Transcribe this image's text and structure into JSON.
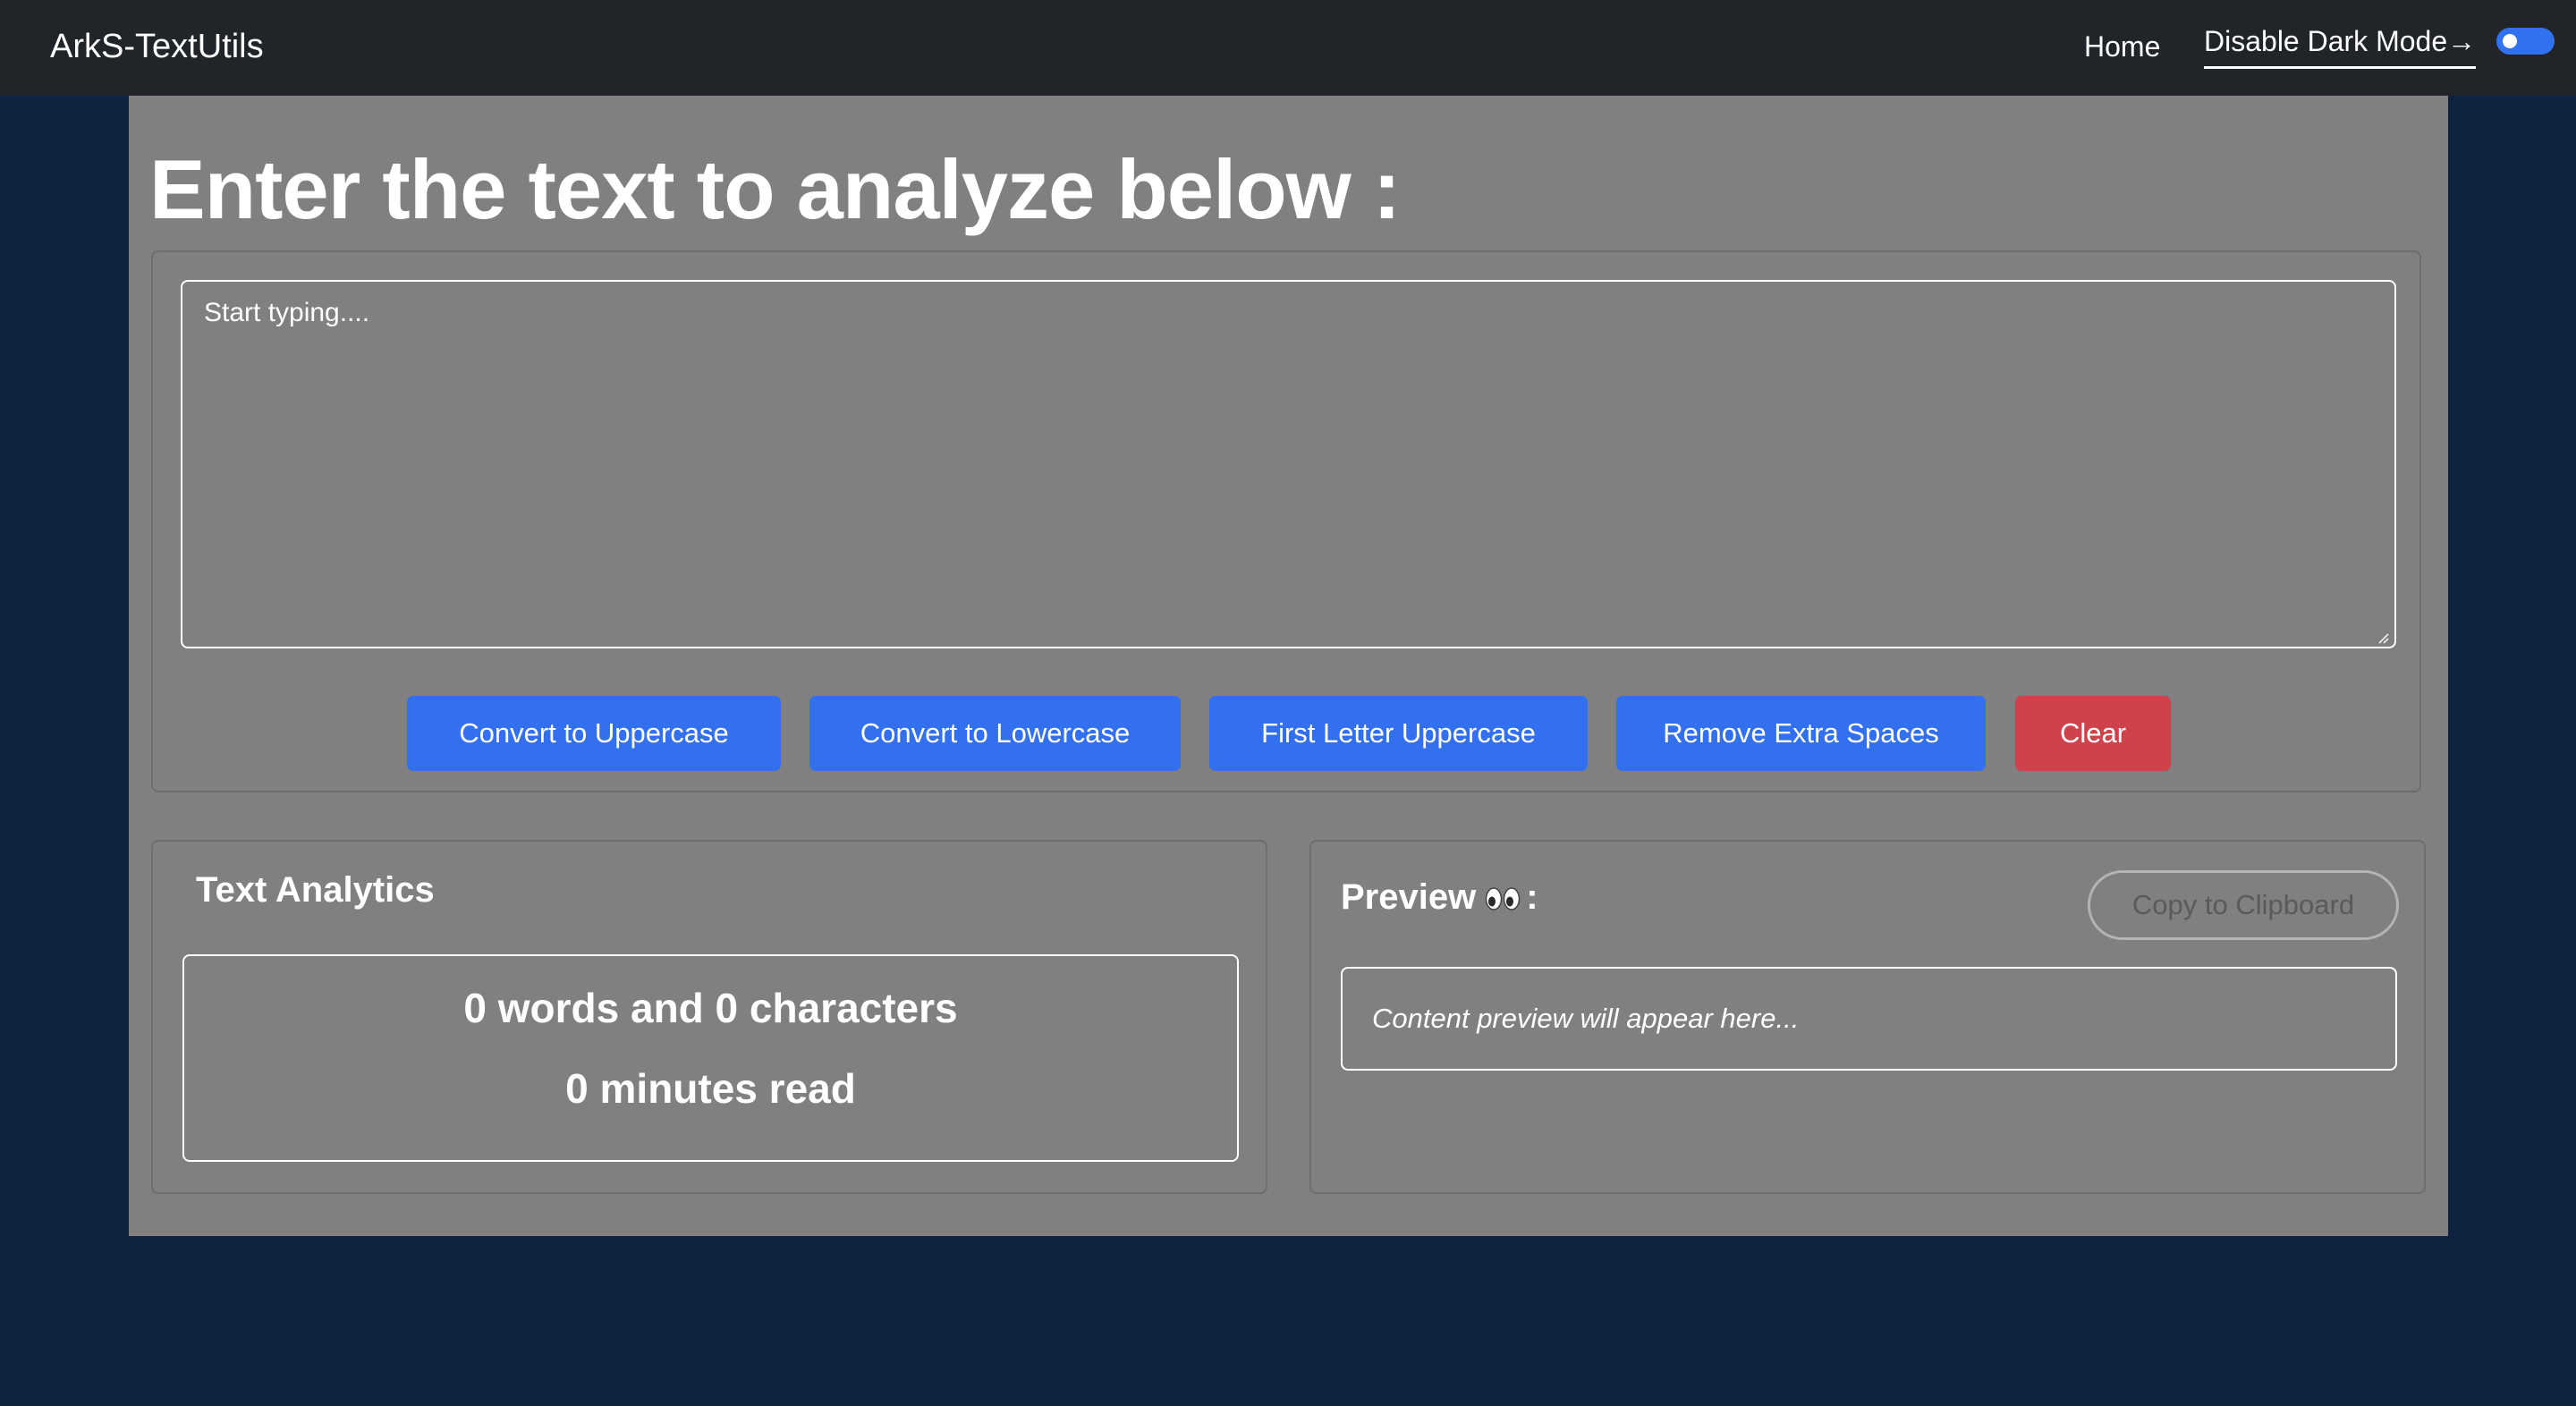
{
  "navbar": {
    "brand": "ArkS-TextUtils",
    "home_label": "Home",
    "dark_mode_label": "Disable Dark Mode→",
    "dark_mode_enabled": true,
    "toggle_color": "#3071f0"
  },
  "main": {
    "heading": "Enter the text to analyze below :",
    "textarea": {
      "placeholder": "Start typing....",
      "value": ""
    },
    "buttons": {
      "uppercase": "Convert to Uppercase",
      "lowercase": "Convert to Lowercase",
      "first_letter": "First Letter Uppercase",
      "remove_spaces": "Remove Extra Spaces",
      "clear": "Clear"
    }
  },
  "analytics": {
    "title": "Text Analytics",
    "words_chars": "0 words and 0 characters",
    "read_time": "0 minutes read"
  },
  "preview": {
    "title_prefix": "Preview",
    "title_suffix": ":",
    "icon": "eyes-icon",
    "copy_label": "Copy to Clipboard",
    "placeholder": "Content preview will appear here..."
  },
  "colors": {
    "navbar_bg": "#212529",
    "page_bg": "#0f2341",
    "container_bg": "#808080",
    "primary": "#3270f0",
    "danger": "#d0424b"
  }
}
